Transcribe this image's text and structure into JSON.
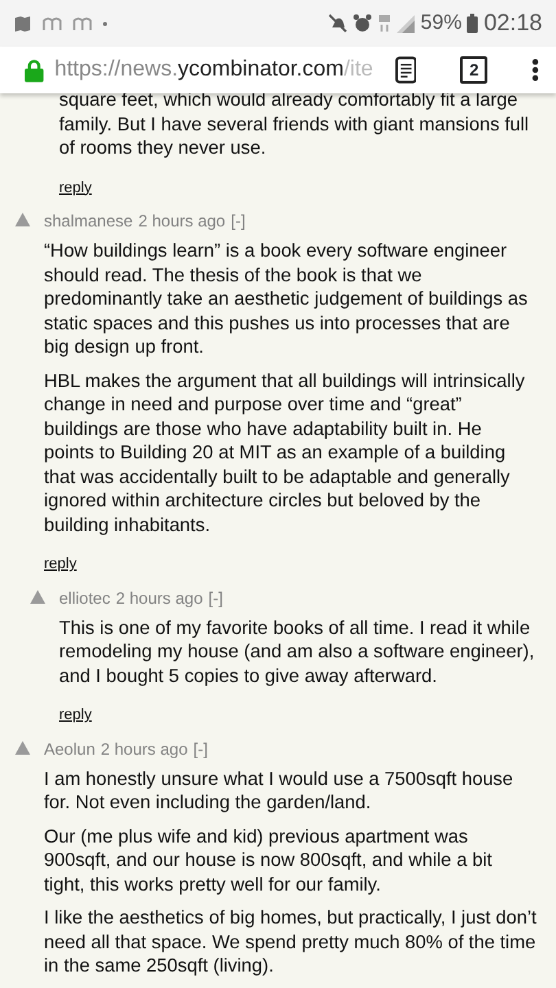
{
  "status_bar": {
    "battery": "59%",
    "time": "02:18"
  },
  "address_bar": {
    "url_start": "https://news.",
    "url_domain": "ycombinator.com",
    "url_end": "/ite",
    "tab_count": "2"
  },
  "thread": [
    {
      "children": [
        {
          "paragraphs": [
            "square feet, which would already comfortably fit a large family. But I have several friends with giant mansions full of rooms they never use."
          ],
          "reply": "reply"
        }
      ]
    },
    {
      "user": "shalmanese",
      "age": "2 hours ago",
      "toggle": "[-]",
      "paragraphs": [
        "“How buildings learn” is a book every software engineer should read. The thesis of the book is that we predominantly take an aesthetic judgement of buildings as static spaces and this pushes us into processes that are big design up front.",
        "HBL makes the argument that all buildings will intrinsically change in need and purpose over time and “great” buildings are those who have adaptability built in. He points to Building 20 at MIT as an example of a building that was accidentally built to be adaptable and generally ignored within architecture circles but beloved by the building inhabitants."
      ],
      "reply": "reply",
      "children": [
        {
          "user": "elliotec",
          "age": "2 hours ago",
          "toggle": "[-]",
          "paragraphs": [
            "This is one of my favorite books of all time. I read it while remodeling my house (and am also a software engineer), and I bought 5 copies to give away afterward."
          ],
          "reply": "reply"
        }
      ]
    },
    {
      "user": "Aeolun",
      "age": "2 hours ago",
      "toggle": "[-]",
      "paragraphs": [
        "I am honestly unsure what I would use a 7500sqft house for. Not even including the garden/land.",
        "Our (me plus wife and kid) previous apartment was 900sqft, and our house is now 800sqft, and while a bit tight, this works pretty well for our family.",
        "I like the aesthetics of big homes, but practically, I just don’t need all that space. We spend pretty much 80% of the time in the same 250sqft (living)."
      ]
    }
  ]
}
